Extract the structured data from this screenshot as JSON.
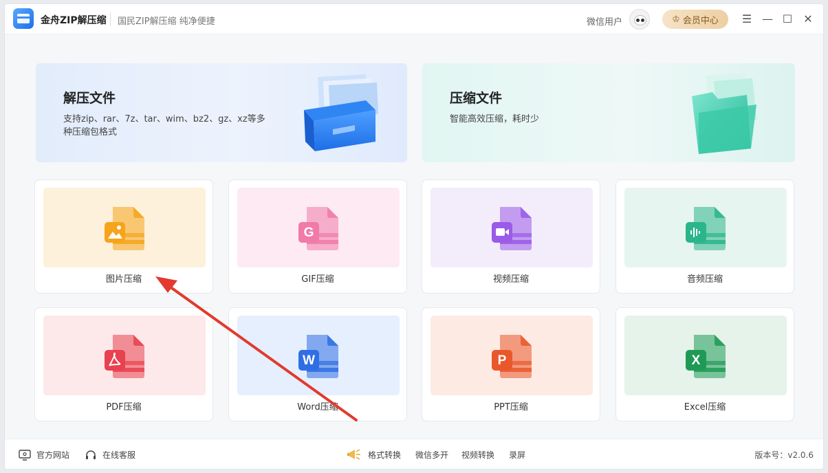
{
  "app": {
    "name": "金舟ZIP解压缩",
    "slogan": "国民ZIP解压缩  纯净便捷"
  },
  "user": {
    "name": "微信用户",
    "member_label": "会员中心"
  },
  "window_controls": {
    "menu": "☰",
    "minimize": "—",
    "maximize": "☐",
    "close": "✕"
  },
  "banners": {
    "extract": {
      "title": "解压文件",
      "desc": "支持zip、rar、7z、tar、wim、bz2、gz、xz等多种压缩包格式"
    },
    "compress": {
      "title": "压缩文件",
      "desc": "智能高效压缩，耗时少"
    }
  },
  "tools": [
    {
      "label": "图片压缩",
      "icon": "image-file-icon",
      "glyph": "",
      "bg": "#fdf1dc",
      "color": "#f6a41c"
    },
    {
      "label": "GIF压缩",
      "icon": "gif-file-icon",
      "glyph": "G",
      "bg": "#fdeaf2",
      "color": "#f07aa8"
    },
    {
      "label": "视频压缩",
      "icon": "video-file-icon",
      "glyph": "",
      "bg": "#f3ecfb",
      "color": "#9a5be8"
    },
    {
      "label": "音频压缩",
      "icon": "audio-file-icon",
      "glyph": "",
      "bg": "#e7f5f0",
      "color": "#2bb58a"
    },
    {
      "label": "PDF压缩",
      "icon": "pdf-file-icon",
      "glyph": "",
      "bg": "#fde8ea",
      "color": "#e8414f"
    },
    {
      "label": "Word压缩",
      "icon": "word-file-icon",
      "glyph": "W",
      "bg": "#e6effd",
      "color": "#2f6fe3"
    },
    {
      "label": "PPT压缩",
      "icon": "ppt-file-icon",
      "glyph": "P",
      "bg": "#fdebe3",
      "color": "#e9582b"
    },
    {
      "label": "Excel压缩",
      "icon": "excel-file-icon",
      "glyph": "X",
      "bg": "#e5f3ea",
      "color": "#1f9a56"
    }
  ],
  "footer": {
    "website": "官方网站",
    "support": "在线客服",
    "links": [
      "格式转换",
      "微信多开",
      "视频转换",
      "录屏"
    ],
    "version": "版本号：v2.0.6"
  },
  "colors": {
    "accent": "#1f6fe8",
    "arrow": "#e23a2e"
  }
}
